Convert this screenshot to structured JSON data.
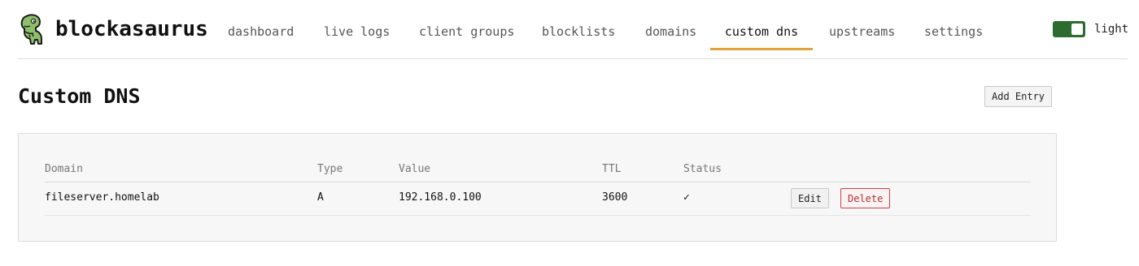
{
  "app": {
    "brand_name": "blockasaurus",
    "logo_icon": "dinosaur-icon",
    "accent_color": "#e0a23c",
    "toggle_color": "#2e6b30"
  },
  "nav": {
    "tabs": [
      {
        "label": "dashboard",
        "active": false
      },
      {
        "label": "live logs",
        "active": false
      },
      {
        "label": "client groups",
        "active": false
      },
      {
        "label": "blocklists",
        "active": false
      },
      {
        "label": "domains",
        "active": false
      },
      {
        "label": "custom dns",
        "active": true
      },
      {
        "label": "upstreams",
        "active": false
      },
      {
        "label": "settings",
        "active": false
      }
    ]
  },
  "theme_toggle": {
    "label": "light",
    "on": true
  },
  "page": {
    "title": "Custom DNS",
    "add_button_label": "Add Entry"
  },
  "table": {
    "columns": [
      "Domain",
      "Type",
      "Value",
      "TTL",
      "Status"
    ],
    "rows": [
      {
        "domain": "fileserver.homelab",
        "type": "A",
        "value": "192.168.0.100",
        "ttl": "3600",
        "status": "✓",
        "edit_label": "Edit",
        "delete_label": "Delete"
      }
    ]
  }
}
